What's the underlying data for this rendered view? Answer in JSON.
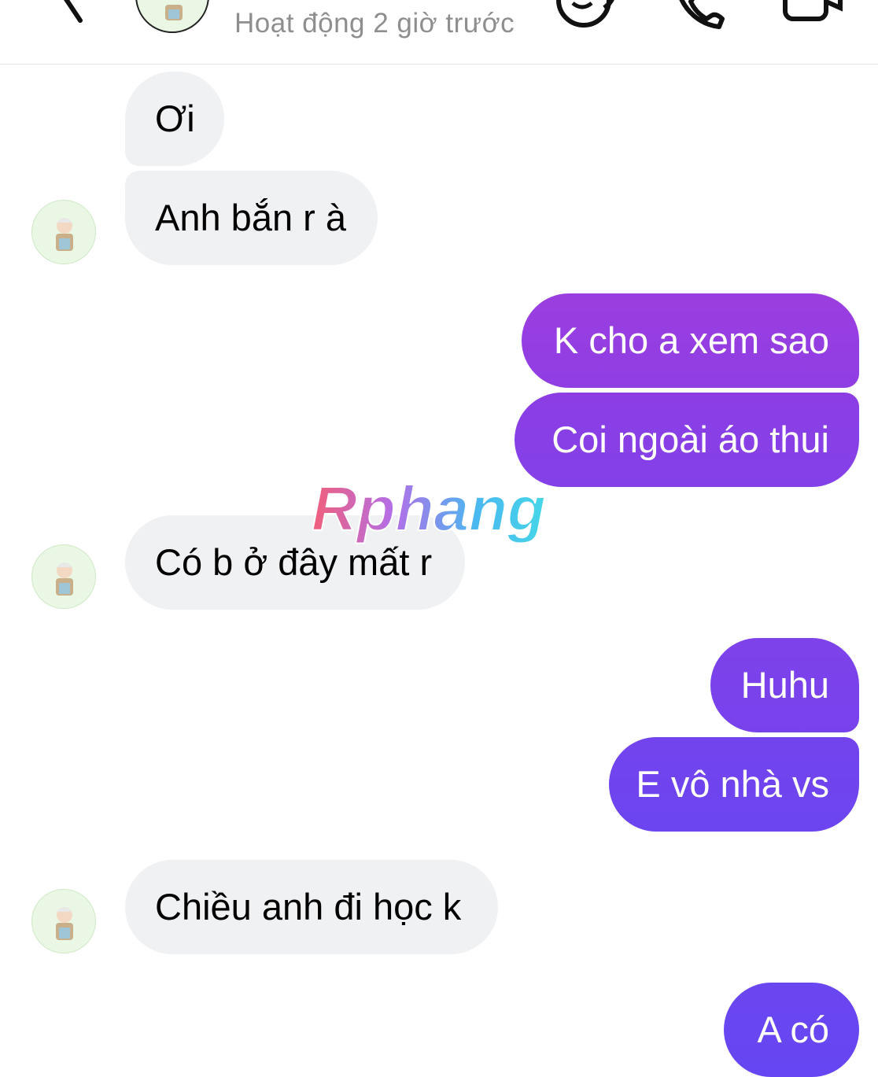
{
  "header": {
    "status": "Hoạt động 2 giờ trước",
    "icons": [
      "back-chevron-icon",
      "contact-avatar",
      "face-icon",
      "phone-icon",
      "video-icon"
    ]
  },
  "messages": [
    {
      "side": "in",
      "text": "Ơi"
    },
    {
      "side": "in",
      "text": "Anh bắn r à"
    },
    {
      "side": "out",
      "text": "K cho a xem sao"
    },
    {
      "side": "out",
      "text": "Coi ngoài áo thui"
    },
    {
      "side": "in",
      "text": "Có b ở đây mất r"
    },
    {
      "side": "out",
      "text": "Huhu"
    },
    {
      "side": "out",
      "text": "E vô nhà vs"
    },
    {
      "side": "in",
      "text": "Chiều anh đi học k"
    },
    {
      "side": "out",
      "text": "A có"
    }
  ],
  "watermark": {
    "text": "Rphang"
  },
  "colors": {
    "incoming_bubble": "#f0f1f3",
    "outgoing_gradient_top": "#9b3ee0",
    "outgoing_gradient_bottom": "#6a3ef0",
    "status_text": "#8e8e8e"
  }
}
